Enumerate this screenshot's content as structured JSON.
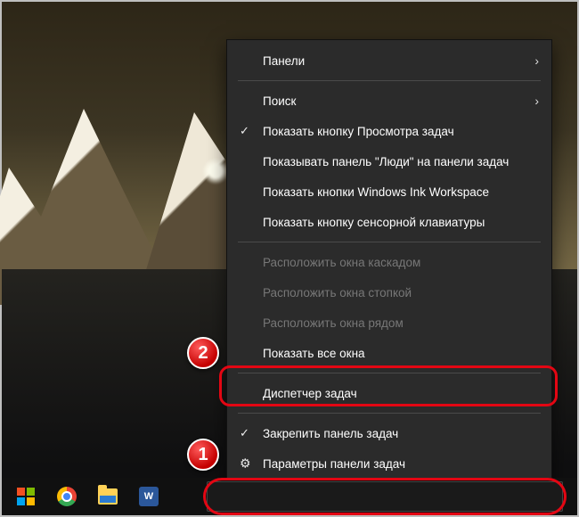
{
  "menu": {
    "panels": "Панели",
    "search": "Поиск",
    "show_taskview": "Показать кнопку Просмотра задач",
    "show_people": "Показывать панель \"Люди\" на панели задач",
    "show_ink": "Показать кнопки Windows Ink Workspace",
    "show_touchkb": "Показать кнопку сенсорной клавиатуры",
    "cascade": "Расположить окна каскадом",
    "stacked": "Расположить окна стопкой",
    "sidebyside": "Расположить окна рядом",
    "show_all": "Показать все окна",
    "task_manager": "Диспетчер задач",
    "lock_taskbar": "Закрепить панель задач",
    "settings": "Параметры панели задач"
  },
  "badges": {
    "one": "1",
    "two": "2"
  },
  "taskbar": {
    "word_label": "W"
  }
}
